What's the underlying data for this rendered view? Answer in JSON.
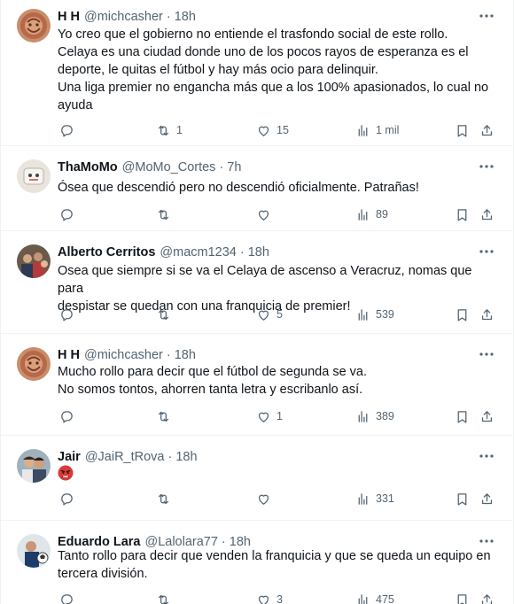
{
  "tweets": [
    {
      "name": "H H",
      "handle": "@michcasher",
      "time": "18h",
      "lines": [
        "Yo creo que el gobierno no entiende el trasfondo social de este rollo.",
        "Celaya es una ciudad donde uno de los pocos rayos de esperanza es el",
        "deporte, le quitas el fútbol y hay más ocio para delinquir.",
        "Una liga premier no engancha más que a los 100% apasionados, lo cual no",
        "ayuda"
      ],
      "retweets": "1",
      "likes": "15",
      "views": "1 mil",
      "avatar": "avatar-hh-icon"
    },
    {
      "name": "ThaMoMo",
      "handle": "@MoMo_Cortes",
      "time": "7h",
      "lines": [
        "Ósea que descendió pero no descendió oficialmente. Patrañas!"
      ],
      "retweets": "",
      "likes": "",
      "views": "89",
      "avatar": "avatar-thamomo-icon"
    },
    {
      "name": "Alberto Cerritos",
      "handle": "@macm1234",
      "time": "18h",
      "lines": [
        "Osea que siempre si se va el Celaya de ascenso a Veracruz, nomas que para",
        "despistar se quedan con una franquicia de premier!"
      ],
      "retweets": "",
      "likes": "5",
      "views": "539",
      "avatar": "avatar-alberto-icon"
    },
    {
      "name": "H H",
      "handle": "@michcasher",
      "time": "18h",
      "lines": [
        "Mucho rollo para decir que el fútbol de segunda se va.",
        "No somos tontos, ahorren tanta letra y escribanlo así."
      ],
      "retweets": "",
      "likes": "1",
      "views": "389",
      "avatar": "avatar-hh-icon"
    },
    {
      "name": "Jair",
      "handle": "@JaiR_tRova",
      "time": "18h",
      "lines": [],
      "emoji": "angry-face-emoji",
      "retweets": "",
      "likes": "",
      "views": "331",
      "avatar": "avatar-jair-icon"
    },
    {
      "name": "Eduardo Lara",
      "handle": "@Lalolara77",
      "time": "18h",
      "lines": [
        "Tanto rollo para decir que venden la franquicia y que se queda un equipo en",
        "tercera división."
      ],
      "retweets": "",
      "likes": "3",
      "views": "475",
      "avatar": "avatar-eduardo-icon"
    }
  ],
  "colors": {
    "text": "#0f1419",
    "secondary": "#536471",
    "divider": "#eff3f4"
  }
}
